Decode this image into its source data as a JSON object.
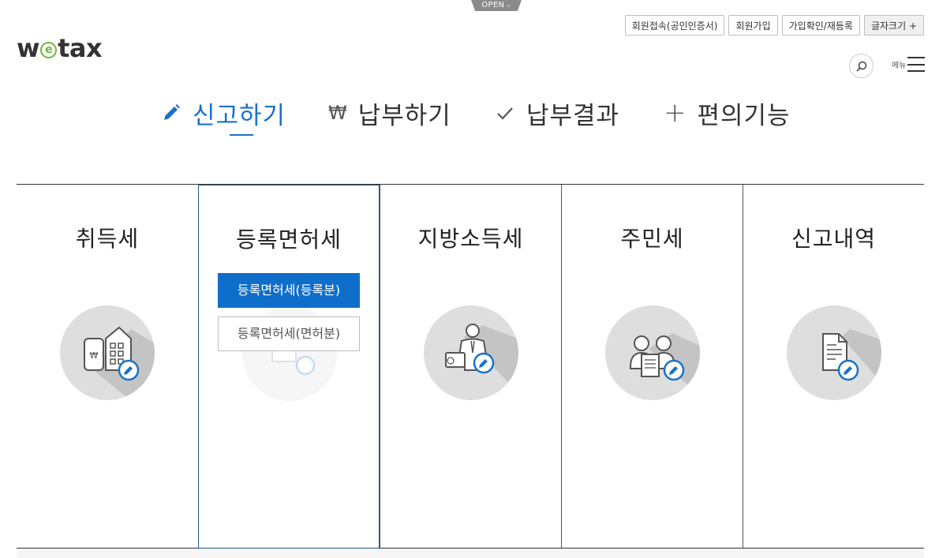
{
  "open_tab": {
    "label": "OPEN"
  },
  "logo": {
    "pre": "w",
    "mid": "e",
    "post": "tax"
  },
  "util": {
    "login_cert": "회원접속(공인인증서)",
    "signup": "회원가입",
    "confirm": "가입확인/재등록",
    "font_size": "글자크기 +"
  },
  "menu": {
    "label": "메뉴"
  },
  "tabs": [
    {
      "label": "신고하기",
      "icon": "pencil-icon",
      "active": true
    },
    {
      "label": "납부하기",
      "icon": "won-icon",
      "active": false
    },
    {
      "label": "납부결과",
      "icon": "check-icon",
      "active": false
    },
    {
      "label": "편의기능",
      "icon": "plus-icon",
      "active": false
    }
  ],
  "categories": [
    {
      "title": "취득세",
      "icon": "building-won-icon"
    },
    {
      "title": "등록면허세",
      "icon": "document-icon",
      "sub_buttons": [
        "등록면허세(등록분)",
        "등록면허세(면허분)"
      ]
    },
    {
      "title": "지방소득세",
      "icon": "businessman-icon"
    },
    {
      "title": "주민세",
      "icon": "people-document-icon"
    },
    {
      "title": "신고내역",
      "icon": "report-document-icon"
    }
  ],
  "colors": {
    "accent": "#1a72c7",
    "button_primary": "#0f6ec9",
    "logo_green": "#6bb838"
  }
}
